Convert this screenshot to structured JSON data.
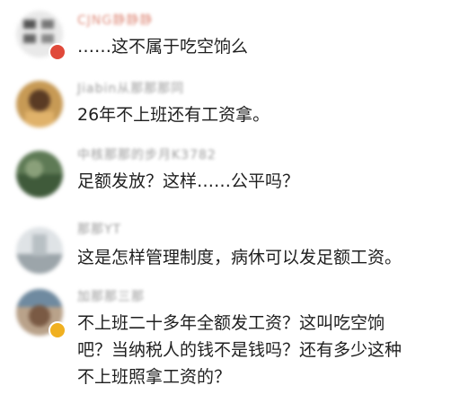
{
  "comments": [
    {
      "name": "CJNG静静静",
      "text": "……这不属于吃空饷么"
    },
    {
      "name": "Jiabin从那那那同",
      "text": "26年不上班还有工资拿。"
    },
    {
      "name": "中核那那的步月K3782",
      "text": "足额发放？这样……公平吗？"
    },
    {
      "name": "那那YT",
      "text": "这是怎样管理制度，病休可以发足额工资。"
    },
    {
      "name": "加那那三那",
      "text_lines": [
        "不上班二十多年全额发工资？这叫吃空饷",
        "吧？当纳税人的钱不是钱吗？还有多少这种",
        "不上班照拿工资的？"
      ]
    }
  ]
}
